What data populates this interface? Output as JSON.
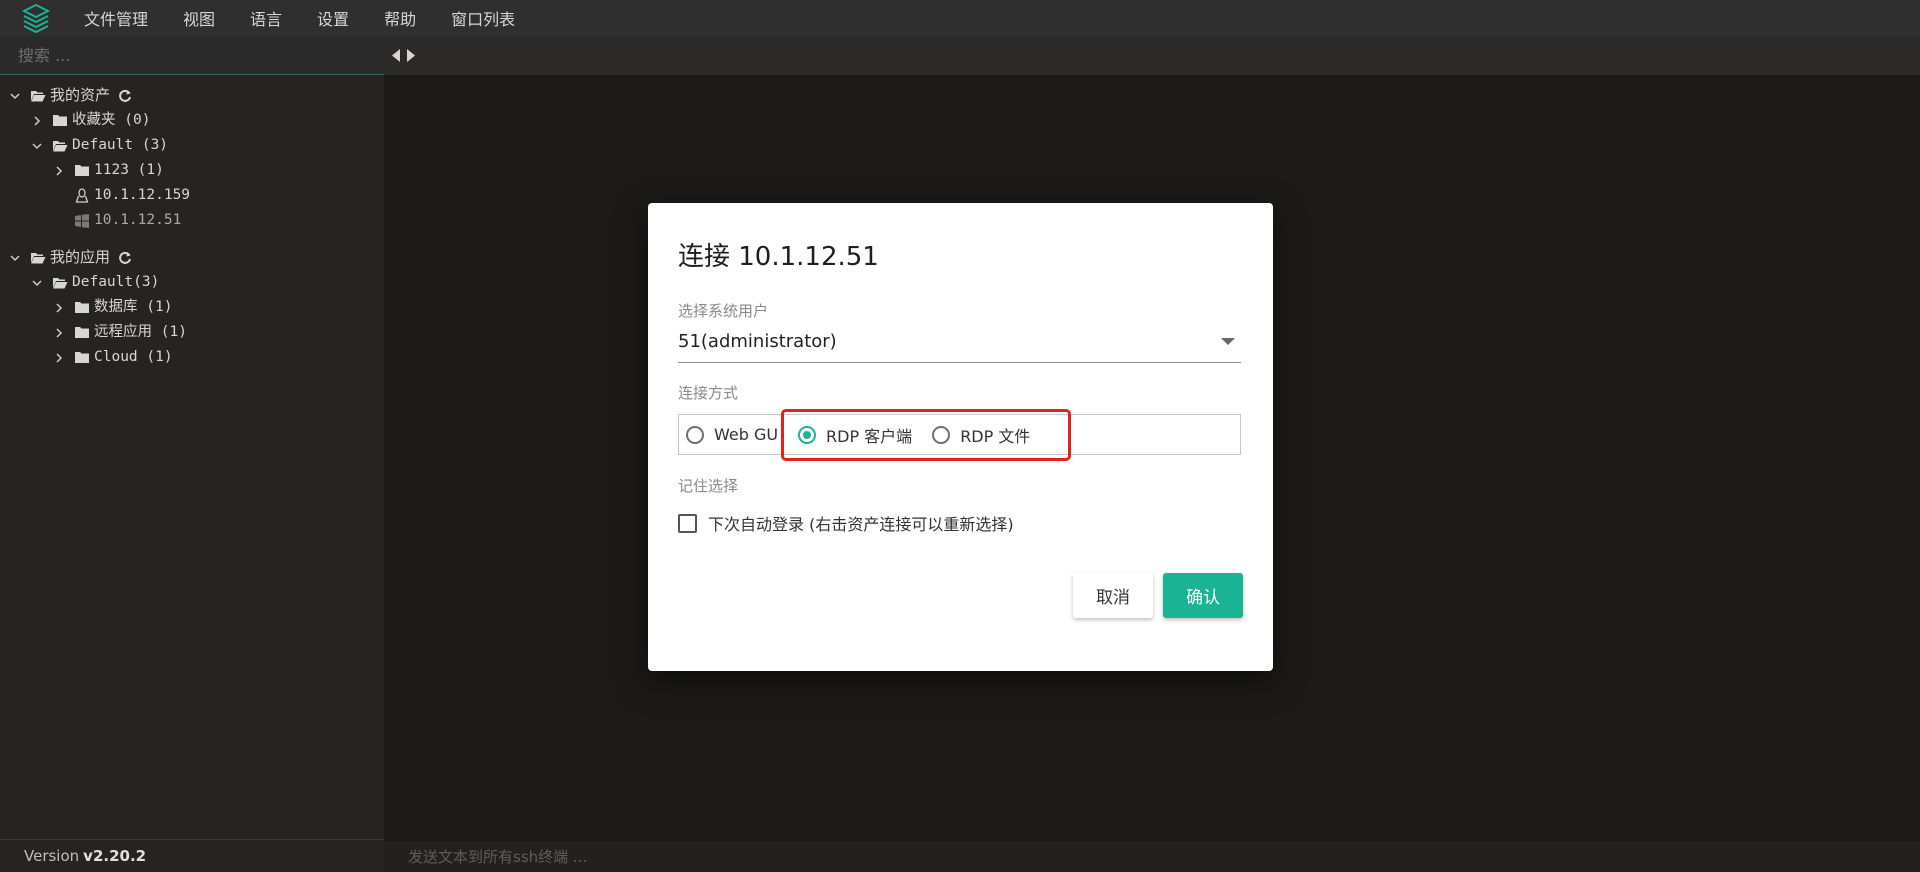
{
  "menubar": {
    "items": [
      "文件管理",
      "视图",
      "语言",
      "设置",
      "帮助",
      "窗口列表"
    ]
  },
  "sidebar": {
    "search_placeholder": "搜索 ...",
    "assets": {
      "label": "我的资产",
      "favorites": "收藏夹 (0)",
      "default_group": "Default (3)",
      "subgroup": "1123 (1)",
      "host_linux": "10.1.12.159",
      "host_windows": "10.1.12.51"
    },
    "apps": {
      "label": "我的应用",
      "default_group": "Default(3)",
      "database": "数据库 (1)",
      "remote_app": "远程应用 (1)",
      "cloud": "Cloud (1)"
    }
  },
  "status": {
    "version_prefix": "Version",
    "version": "v2.20.2",
    "broadcast_placeholder": "发送文本到所有ssh终端 ..."
  },
  "dialog": {
    "title": "连接 10.1.12.51",
    "system_user_label": "选择系统用户",
    "system_user_value": "51(administrator)",
    "connect_method_label": "连接方式",
    "methods": [
      {
        "label": "Web GUI",
        "selected": false
      },
      {
        "label": "RDP 客户端",
        "selected": true
      },
      {
        "label": "RDP 文件",
        "selected": false
      }
    ],
    "remember_label": "记住选择",
    "auto_login_label": "下次自动登录 (右击资产连接可以重新选择)",
    "cancel_label": "取消",
    "confirm_label": "确认"
  },
  "colors": {
    "accent": "#1ab394",
    "highlight": "#e2231a"
  }
}
